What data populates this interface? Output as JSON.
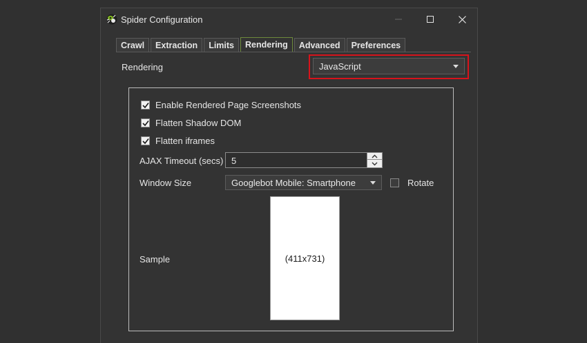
{
  "window": {
    "title": "Spider Configuration"
  },
  "tabs": [
    {
      "label": "Crawl",
      "active": false
    },
    {
      "label": "Extraction",
      "active": false
    },
    {
      "label": "Limits",
      "active": false
    },
    {
      "label": "Rendering",
      "active": true
    },
    {
      "label": "Advanced",
      "active": false
    },
    {
      "label": "Preferences",
      "active": false
    }
  ],
  "rendering": {
    "label": "Rendering",
    "selected": "JavaScript"
  },
  "options": {
    "screenshots": {
      "label": "Enable Rendered Page Screenshots",
      "checked": true
    },
    "shadow_dom": {
      "label": "Flatten Shadow DOM",
      "checked": true
    },
    "iframes": {
      "label": "Flatten iframes",
      "checked": true
    }
  },
  "ajax": {
    "label": "AJAX Timeout (secs)",
    "value": "5"
  },
  "window_size": {
    "label": "Window Size",
    "selected": "Googlebot Mobile: Smartphone",
    "rotate_label": "Rotate",
    "rotate_checked": false
  },
  "sample": {
    "label": "Sample",
    "dimensions": "(411x731)"
  },
  "colors": {
    "highlight": "#d8131b",
    "active_tab_border": "#6d8a3c"
  }
}
